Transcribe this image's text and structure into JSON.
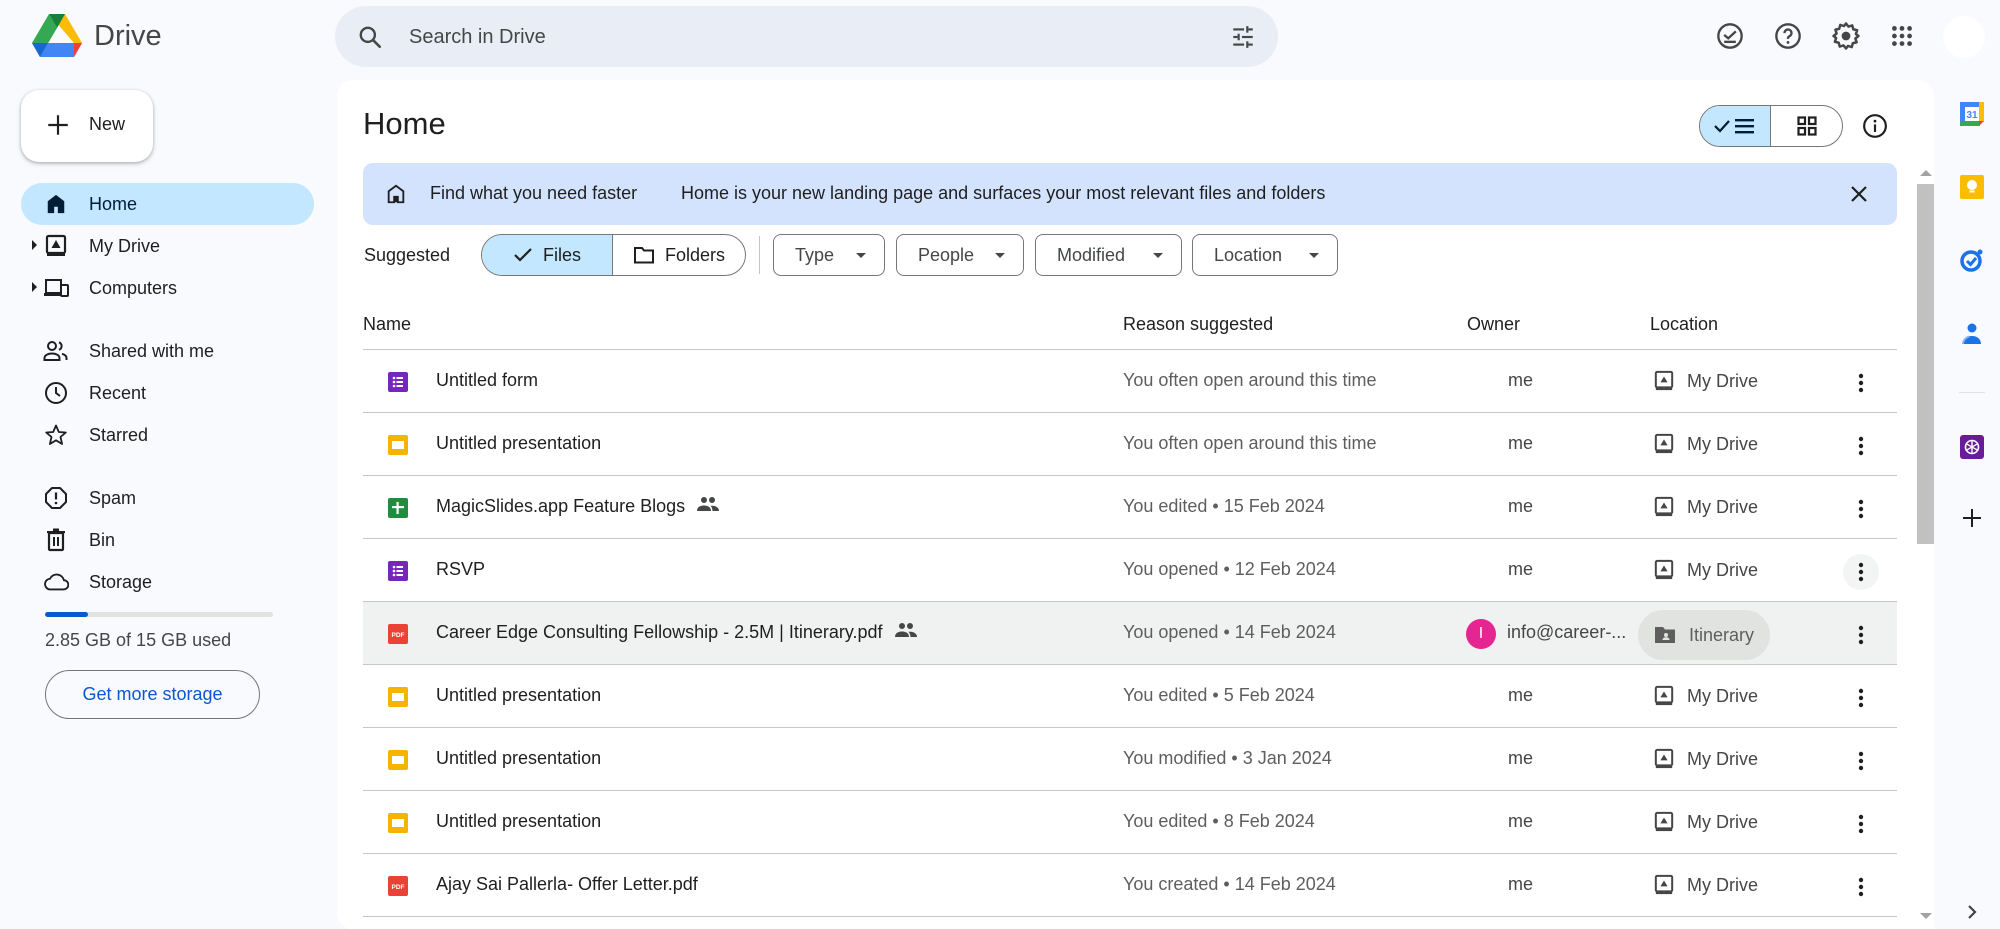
{
  "app": {
    "name": "Drive"
  },
  "search": {
    "placeholder": "Search in Drive",
    "value": ""
  },
  "topbar": {
    "icons": [
      "offline-ready-icon",
      "help-icon",
      "settings-icon",
      "apps-grid-icon",
      "account-avatar"
    ]
  },
  "sidebar": {
    "new_label": "New",
    "items": [
      {
        "label": "Home",
        "icon": "home-icon",
        "active": true
      },
      {
        "label": "My Drive",
        "icon": "my-drive-icon",
        "expandable": true
      },
      {
        "label": "Computers",
        "icon": "computers-icon",
        "expandable": true
      },
      {
        "label": "Shared with me",
        "icon": "shared-icon"
      },
      {
        "label": "Recent",
        "icon": "clock-icon"
      },
      {
        "label": "Starred",
        "icon": "star-icon"
      },
      {
        "label": "Spam",
        "icon": "spam-icon"
      },
      {
        "label": "Bin",
        "icon": "trash-icon"
      },
      {
        "label": "Storage",
        "icon": "cloud-icon"
      }
    ],
    "storage": {
      "used_gb": 2.85,
      "total_gb": 15,
      "fraction_used": 0.19,
      "text": "2.85 GB of 15 GB used",
      "button_label": "Get more storage"
    }
  },
  "main": {
    "title": "Home",
    "view_mode": "list",
    "banner": {
      "title": "Find what you need faster",
      "text": "Home is your new landing page and surfaces your most relevant files and folders"
    },
    "filters": {
      "label": "Suggested",
      "segments": [
        {
          "label": "Files",
          "selected": true
        },
        {
          "label": "Folders",
          "selected": false
        }
      ],
      "chips": [
        "Type",
        "People",
        "Modified",
        "Location"
      ]
    },
    "columns": [
      "Name",
      "Reason suggested",
      "Owner",
      "Location"
    ],
    "rows": [
      {
        "name": "Untitled form",
        "type": "form",
        "shared": false,
        "reason": "You often open around this time",
        "owner": "me",
        "location": "My Drive"
      },
      {
        "name": "Untitled presentation",
        "type": "slides",
        "shared": false,
        "reason": "You often open around this time",
        "owner": "me",
        "location": "My Drive"
      },
      {
        "name": "MagicSlides.app Feature Blogs",
        "type": "sheets",
        "shared": true,
        "reason": "You edited • 15 Feb 2024",
        "owner": "me",
        "location": "My Drive"
      },
      {
        "name": "RSVP",
        "type": "form",
        "shared": false,
        "reason": "You opened • 12 Feb 2024",
        "owner": "me",
        "location": "My Drive"
      },
      {
        "name": "Career Edge Consulting Fellowship - 2.5M | Itinerary.pdf",
        "type": "pdf",
        "shared": true,
        "reason": "You opened • 14 Feb 2024",
        "owner": "info@career-...",
        "owner_initial": "I",
        "location": "Itinerary",
        "location_type": "shared-folder"
      },
      {
        "name": "Untitled presentation",
        "type": "slides",
        "shared": false,
        "reason": "You edited • 5 Feb 2024",
        "owner": "me",
        "location": "My Drive"
      },
      {
        "name": "Untitled presentation",
        "type": "slides",
        "shared": false,
        "reason": "You modified • 3 Jan 2024",
        "owner": "me",
        "location": "My Drive"
      },
      {
        "name": "Untitled presentation",
        "type": "slides",
        "shared": false,
        "reason": "You edited • 8 Feb 2024",
        "owner": "me",
        "location": "My Drive"
      },
      {
        "name": "Ajay Sai Pallerla- Offer Letter.pdf",
        "type": "pdf",
        "shared": false,
        "reason": "You created • 14 Feb 2024",
        "owner": "me",
        "location": "My Drive"
      }
    ]
  },
  "side_panel": {
    "apps": [
      "calendar-icon",
      "keep-icon",
      "tasks-icon",
      "contacts-icon",
      "chatgpt-addon-icon",
      "add-addon-icon"
    ],
    "calendar_day": "31"
  },
  "colors": {
    "accent": "#0b57d0",
    "selected_bg": "#c2e7ff",
    "banner_bg": "#d3e3fd",
    "form": "#7627bb",
    "slides": "#f4b400",
    "sheets": "#1e8e3e",
    "pdf": "#ea4335",
    "owner_avatar": "#e52592"
  }
}
